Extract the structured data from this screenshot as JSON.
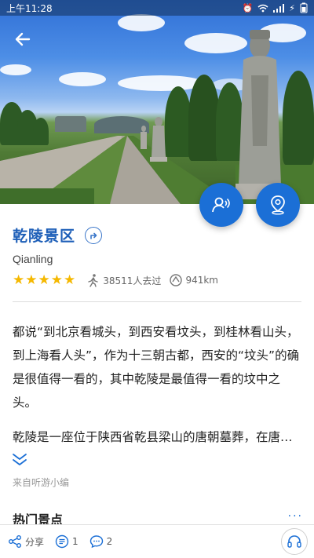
{
  "status_bar": {
    "time": "上午11:28",
    "battery": "⚡"
  },
  "attraction": {
    "title": "乾陵景区",
    "subtitle": "Qianling",
    "rating_stars": 5,
    "visitors": "38511人去过",
    "distance": "941km"
  },
  "description": {
    "paragraph1": "都说“到北京看城头，到西安看坟头，到桂林看山头，到上海看人头”，作为十三朝古都，西安的“坟头”的确是很值得一看的，其中乾陵是最值得一看的坟中之头。",
    "paragraph2": "乾陵是一座位于陕西省乾县梁山的唐朝墓葬，在唐…"
  },
  "source": "来自听游小编",
  "section": {
    "title": "热门景点",
    "more": "···"
  },
  "bottom_bar": {
    "share_label": "分享",
    "notes_count": "1",
    "comments_count": "2"
  },
  "colors": {
    "accent": "#1b6fd6",
    "title": "#1e5fb8",
    "star": "#f5b800"
  },
  "icons": [
    "back-arrow-icon",
    "audio-guide-icon",
    "location-pin-icon",
    "navigate-icon",
    "walker-icon",
    "distance-icon",
    "expand-chevron-icon",
    "share-icon",
    "notes-icon",
    "comments-icon",
    "headphones-icon"
  ]
}
